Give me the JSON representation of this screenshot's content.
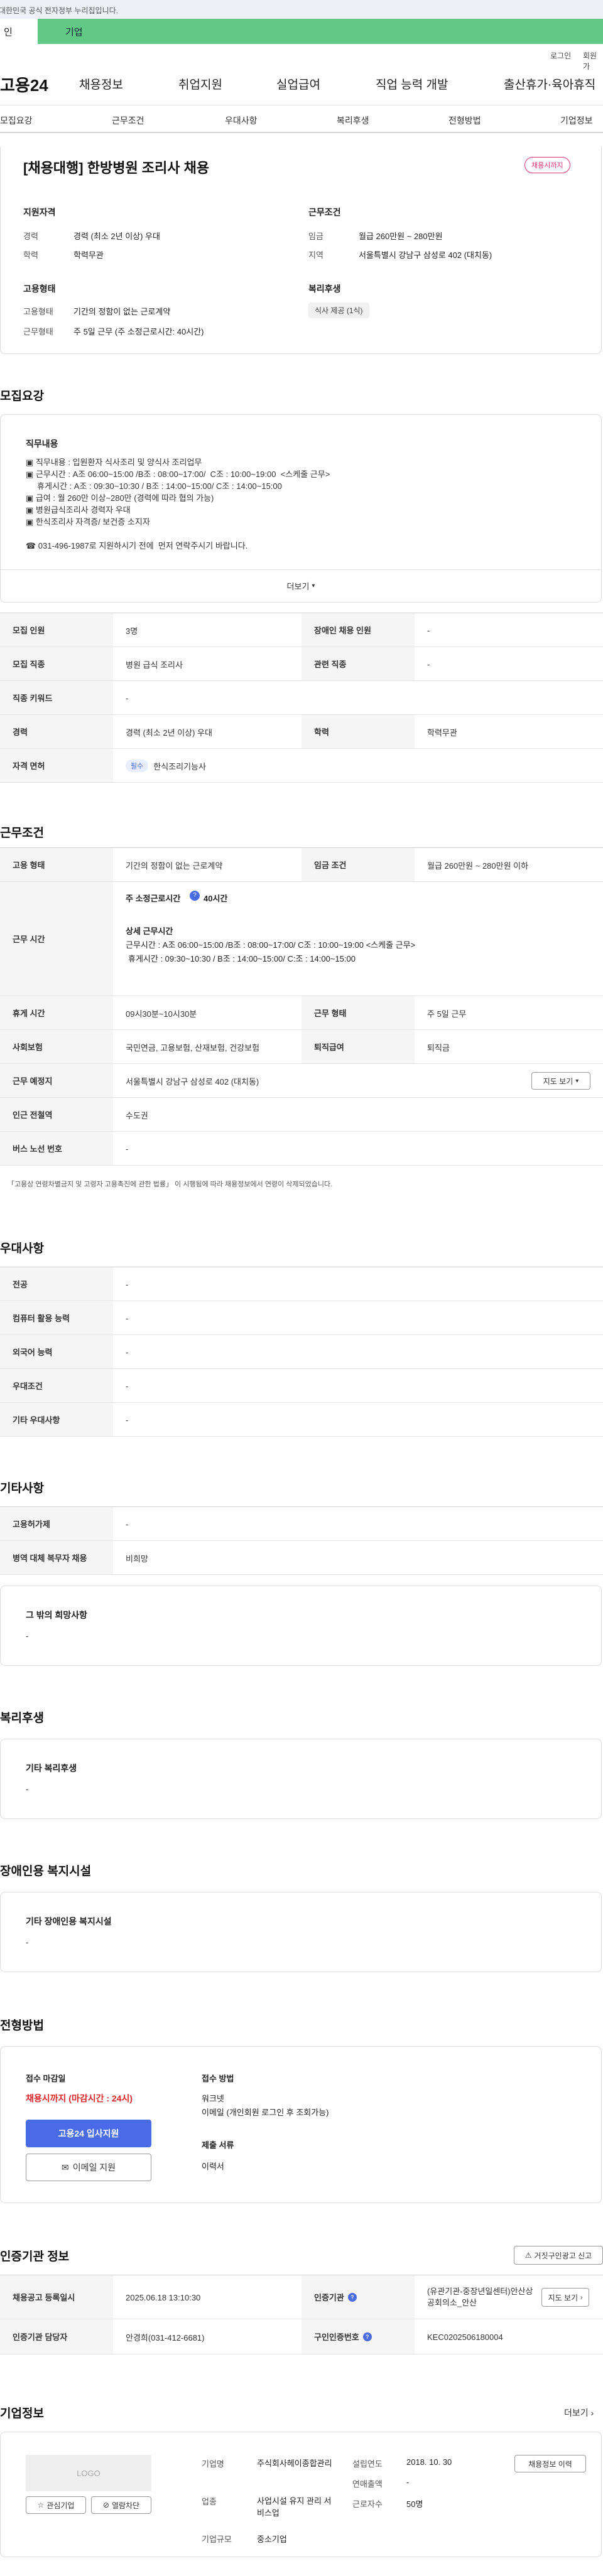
{
  "gov_notice": "대한민국 공식 전자정부 누리집입니다.",
  "user_tabs": {
    "personal": "인",
    "company": "기업"
  },
  "util_links": {
    "login": "로그인",
    "signup": "회원가"
  },
  "gnb": {
    "logo": "고용24",
    "menu": [
      "채용정보",
      "취업지원",
      "실업급여",
      "직업 능력 개발",
      "출산휴가·육아휴직"
    ]
  },
  "tabs": [
    "모집요강",
    "근무조건",
    "우대사항",
    "복리후생",
    "전형방법",
    "기업정보"
  ],
  "summary": {
    "title": "[채용대행] 한방병원 조리사 채용",
    "status_badge": "채용시까지",
    "qual_title": "지원자격",
    "qual": [
      {
        "label": "경력",
        "value": "경력 (최소 2년 이상) 우대"
      },
      {
        "label": "학력",
        "value": "학력무관"
      }
    ],
    "cond_title": "근무조건",
    "cond": [
      {
        "label": "임금",
        "value": "월급 260만원 ~ 280만원"
      },
      {
        "label": "지역",
        "value": "서울특별시 강남구 삼성로 402 (대치동)"
      }
    ],
    "emp_title": "고용형태",
    "emp": [
      {
        "label": "고용형태",
        "value": "기간의 정함이 없는 근로계약"
      },
      {
        "label": "근무형태",
        "value": "주 5일 근무 (주 소정근로시간: 40시간)"
      }
    ],
    "welfare_title": "복리후생",
    "welfare_tag": "식사 제공 (1식)"
  },
  "recruit": {
    "section_title": "모집요강",
    "desc_title": "직무내용",
    "desc_lines": [
      "▣ 직무내용 : 입원환자 식사조리 및 양식사 조리업무",
      "▣ 근무시간 : A조 06:00~15:00 /B조 : 08:00~17:00/  C조 : 10:00~19:00  <스케줄 근무>",
      "     휴게시간 : A조 : 09:30~10:30 / B조 : 14:00~15:00/ C조 : 14:00~15:00",
      "▣ 급여 : 월 260만 이상~280만 (경력에 따라 협의 가능)",
      "▣ 병원급식조리사 경력자 우대",
      "▣ 한식조리사 자격증/ 보건증 소지자",
      "",
      "☎ 031-496-1987로 지원하시기 전에  먼저 연락주시기 바랍니다."
    ],
    "more": "더보기",
    "rows": [
      {
        "label": "모집 인원",
        "value": "3명",
        "label2": "장애인 채용 인원",
        "value2": "-"
      },
      {
        "label": "모집 직종",
        "value": "병원 급식 조리사",
        "label2": "관련 직종",
        "value2": "-"
      },
      {
        "label": "직종 키워드",
        "value": "-"
      },
      {
        "label": "경력",
        "value": "경력 (최소 2년 이상) 우대",
        "label2": "학력",
        "value2": "학력무관"
      },
      {
        "label": "자격 면허",
        "value": "한식조리기능사",
        "tag": "필수"
      }
    ]
  },
  "work": {
    "section_title": "근무조건",
    "emp_type_label": "고용 형태",
    "emp_type": "기간의 정함이 없는 근로계약",
    "wage_label": "임금 조건",
    "wage": "월급 260만원 ~ 280만원 이하",
    "hours_label": "근무 시간",
    "hours_main": "주 소정근로시간",
    "hours_value": "40시간",
    "hours_detail_title": "상세 근무시간",
    "hours_detail": [
      "근무시간 : A조 06:00~15:00  /B조 : 08:00~17:00/  C조 : 10:00~19:00  <스케줄 근무>",
      "휴게시간 : 09:30~10:30 / B조 : 14:00~15:00/ C:조 : 14:00~15:00"
    ],
    "break_label": "휴게 시간",
    "break": "09시30분~10시30분",
    "shift_label": "근무 형태",
    "shift": "주 5일 근무",
    "insurance_label": "사회보험",
    "insurance": "국민연금, 고용보험, 산재보험, 건강보험",
    "severance_label": "퇴직급여",
    "severance": "퇴직금",
    "location_label": "근무 예정지",
    "location": "서울특별시 강남구 삼성로 402 (대치동)",
    "map_button": "지도 보기",
    "station_label": "인근 전철역",
    "station": "수도권",
    "bus_label": "버스 노선 번호",
    "bus": "-",
    "footnote": "「고용상 연령차별금지 및 고령자 고용촉진에 관한 법률」 이 시행됨에 따라 채용정보에서 연령이 삭제되었습니다."
  },
  "pref": {
    "section_title": "우대사항",
    "rows": [
      {
        "label": "전공",
        "value": "-"
      },
      {
        "label": "컴퓨터 활용 능력",
        "value": "-"
      },
      {
        "label": "외국어 능력",
        "value": "-"
      },
      {
        "label": "우대조건",
        "value": "-"
      },
      {
        "label": "기타 우대사항",
        "value": "-"
      }
    ]
  },
  "etc": {
    "section_title": "기타사항",
    "rows": [
      {
        "label": "고용허가제",
        "value": "-"
      },
      {
        "label": "병역 대체 복무자 채용",
        "value": "비희망"
      }
    ],
    "other_title": "그 밖의 희망사항",
    "other_value": "-"
  },
  "welfare": {
    "section_title": "복리후생",
    "box_title": "기타 복리후생",
    "box_value": "-"
  },
  "disabled": {
    "section_title": "장애인용 복지시설",
    "box_title": "기타 장애인용 복지시설",
    "box_value": "-"
  },
  "apply": {
    "section_title": "전형방법",
    "deadline_label": "접수 마감일",
    "deadline": "채용시까지 (마감시간 : 24시)",
    "apply_button": "고용24 입사지원",
    "email_button": "이메일 지원",
    "method_label": "접수 방법",
    "methods": [
      "워크넷",
      "이메일 (개인회원 로그인 후 조회가능)"
    ],
    "docs_label": "제출 서류",
    "docs": "이력서"
  },
  "agency": {
    "section_title": "인증기관 정보",
    "report_button": "거짓구인광고 신고",
    "rows": [
      {
        "label": "채용공고 등록일시",
        "value": "2025.06.18 13:10:30",
        "label2": "인증기관",
        "value2": "(유관기관-중장년일센터)안산상공회의소_안산",
        "map": "지도 보기"
      },
      {
        "label": "인증기관 담당자",
        "value": "안경희(031-412-6681)",
        "label2": "구인인증번호",
        "value2": "KEC0202506180004"
      }
    ]
  },
  "company": {
    "section_title": "기업정보",
    "more": "더보기",
    "logo": "LOGO",
    "fav_button": "관심기업",
    "block_button": "열람차단",
    "fields": [
      {
        "label": "기업명",
        "value": "주식회사헤이종합관리"
      },
      {
        "label": "업종",
        "value": "사업시설 유지 관리 서비스업"
      },
      {
        "label": "기업규모",
        "value": "중소기업"
      },
      {
        "label": "설립연도",
        "value": "2018. 10. 30"
      },
      {
        "label": "연매출액",
        "value": "-"
      },
      {
        "label": "근로자수",
        "value": "50명"
      }
    ],
    "history_button": "채용정보 이력"
  },
  "colors": {
    "green": "#61c886",
    "pink": "#e8336d",
    "red": "#e0242c",
    "blue": "#4a6be8"
  }
}
